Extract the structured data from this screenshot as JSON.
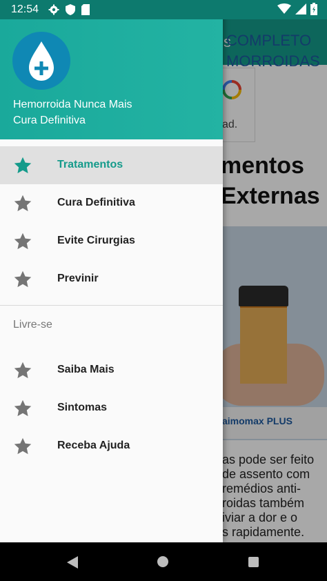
{
  "status_bar": {
    "time": "12:54",
    "left_icons": [
      "gear-icon",
      "shield-icon",
      "sd-card-icon"
    ],
    "right_icons": [
      "wifi-icon",
      "signal-icon",
      "battery-icon"
    ]
  },
  "background_app": {
    "toolbar_title_fragment": "s",
    "ad_text_fragment": "ad.",
    "article_title": "mentos\nExternas",
    "product_headline": "COMPLETO\nMORROIDAS",
    "product_caption": "aimomax PLUS",
    "body_text": "as pode ser feito\nde assento com\nremédios anti-\nroidas também\niviar a dor e o\ns rapidamente."
  },
  "drawer": {
    "app_name": "Hemorroida Nunca Mais",
    "app_subtitle": "Cura Definitiva",
    "primary_items": [
      {
        "label": "Tratamentos",
        "active": true
      },
      {
        "label": "Cura Definitiva",
        "active": false
      },
      {
        "label": "Evite Cirurgias",
        "active": false
      },
      {
        "label": "Previnir",
        "active": false
      }
    ],
    "section_title": "Livre-se",
    "secondary_items": [
      {
        "label": "Saiba Mais"
      },
      {
        "label": "Sintomas"
      },
      {
        "label": "Receba Ajuda"
      }
    ]
  },
  "colors": {
    "accent": "#159b8b",
    "header": "#1aa99b",
    "star_inactive": "#757575",
    "star_active": "#159b8b"
  }
}
